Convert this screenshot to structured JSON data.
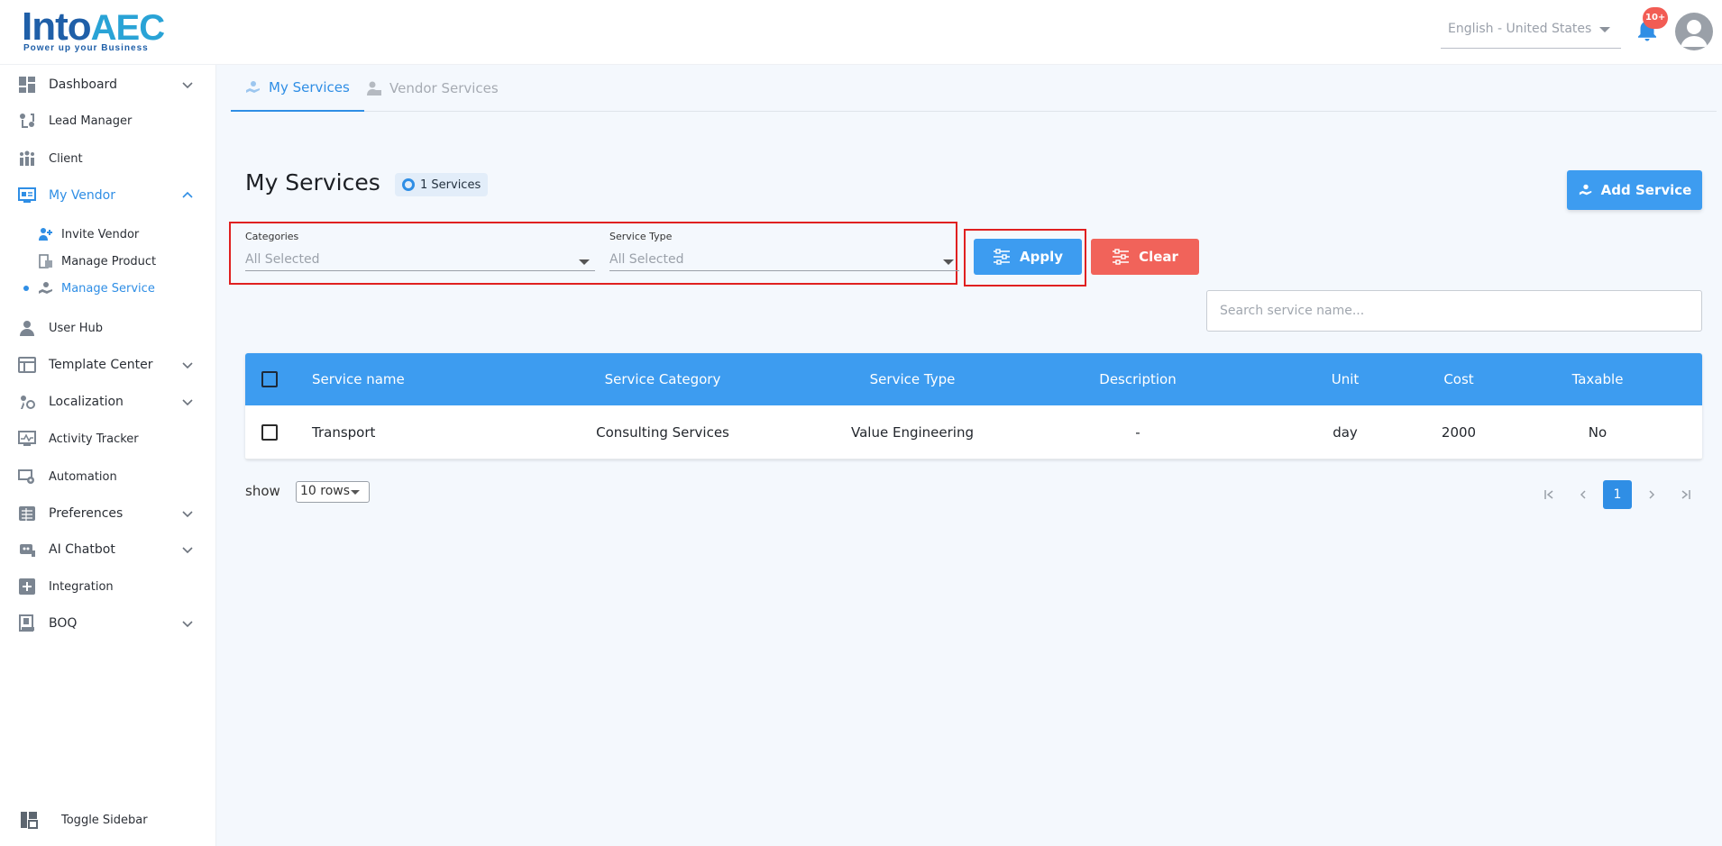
{
  "brand": {
    "name_main": "Into",
    "name_accent": "AEC",
    "tagline": "Power up your Business"
  },
  "header": {
    "language": "English - United States",
    "notification_count": "10+"
  },
  "sidebar": {
    "items": [
      {
        "label": "Dashboard",
        "icon": "dashboard-icon",
        "has_chevron": true
      },
      {
        "label": "Lead Manager",
        "icon": "lead-manager-icon"
      },
      {
        "label": "Client",
        "icon": "client-icon"
      },
      {
        "label": "My Vendor",
        "icon": "vendor-icon",
        "has_chevron": true,
        "expanded": true,
        "active": true
      },
      {
        "label": "User Hub",
        "icon": "user-icon"
      },
      {
        "label": "Template Center",
        "icon": "template-icon",
        "has_chevron": true
      },
      {
        "label": "Localization",
        "icon": "localization-icon",
        "has_chevron": true
      },
      {
        "label": "Activity Tracker",
        "icon": "activity-icon"
      },
      {
        "label": "Automation",
        "icon": "automation-icon"
      },
      {
        "label": "Preferences",
        "icon": "preferences-icon",
        "has_chevron": true
      },
      {
        "label": "AI Chatbot",
        "icon": "chatbot-icon",
        "has_chevron": true
      },
      {
        "label": "Integration",
        "icon": "integration-icon"
      },
      {
        "label": "BOQ",
        "icon": "boq-icon",
        "has_chevron": true
      }
    ],
    "sub_items": [
      {
        "label": "Invite Vendor",
        "icon": "invite-vendor-icon"
      },
      {
        "label": "Manage Product",
        "icon": "manage-product-icon"
      },
      {
        "label": "Manage Service",
        "icon": "manage-service-icon",
        "active": true
      }
    ],
    "toggle_label": "Toggle Sidebar"
  },
  "tabs": [
    {
      "label": "My Services",
      "active": true
    },
    {
      "label": "Vendor Services",
      "active": false
    }
  ],
  "page": {
    "title": "My Services",
    "count_label": "1 Services",
    "add_button": "Add Service"
  },
  "filters": {
    "categories": {
      "label": "Categories",
      "value": "All Selected"
    },
    "service_type": {
      "label": "Service Type",
      "value": "All Selected"
    },
    "apply_label": "Apply",
    "clear_label": "Clear"
  },
  "search": {
    "placeholder": "Search service name..."
  },
  "table": {
    "columns": [
      "Service name",
      "Service Category",
      "Service Type",
      "Description",
      "Unit",
      "Cost",
      "Taxable"
    ],
    "rows": [
      [
        "Transport",
        "Consulting Services",
        "Value Engineering",
        "-",
        "day",
        "2000",
        "No"
      ]
    ]
  },
  "pagination": {
    "show_label": "show",
    "rows_value": "10 rows",
    "current_page": "1"
  },
  "colors": {
    "primary": "#3d9cf0",
    "danger": "#f1635a",
    "highlight_border": "#e02020"
  }
}
